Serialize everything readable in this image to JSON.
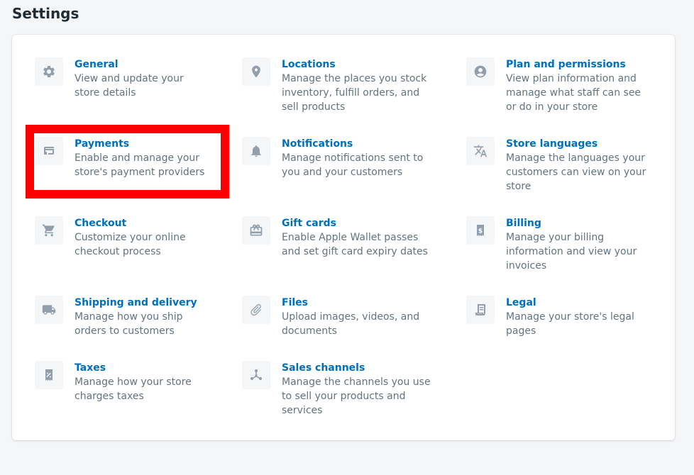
{
  "page_title": "Settings",
  "items": [
    {
      "title": "General",
      "desc_lines": [
        "View and update your",
        "store details"
      ],
      "icon": "gear-icon"
    },
    {
      "title": "Locations",
      "desc_lines": [
        "Manage the places you stock",
        "inventory, fulfill orders, and",
        "sell products"
      ],
      "icon": "location-pin-icon"
    },
    {
      "title": "Plan and permissions",
      "desc_lines": [
        "View plan information and",
        "manage what staff can see",
        "or do in your store"
      ],
      "icon": "user-circle-icon"
    },
    {
      "title": "Payments",
      "desc_lines": [
        "Enable and manage your",
        "store's payment providers"
      ],
      "icon": "credit-card-icon"
    },
    {
      "title": "Notifications",
      "desc_lines": [
        "Manage notifications sent to",
        "you and your customers"
      ],
      "icon": "bell-icon"
    },
    {
      "title": "Store languages",
      "desc_lines": [
        "Manage the languages your",
        "customers can view on your",
        "store"
      ],
      "icon": "translate-icon"
    },
    {
      "title": "Checkout",
      "desc_lines": [
        "Customize your online",
        "checkout process"
      ],
      "icon": "cart-icon"
    },
    {
      "title": "Gift cards",
      "desc_lines": [
        "Enable Apple Wallet passes",
        "and set gift card expiry dates"
      ],
      "icon": "gift-icon"
    },
    {
      "title": "Billing",
      "desc_lines": [
        "Manage your billing",
        "information and view your",
        "invoices"
      ],
      "icon": "billing-receipt-icon"
    },
    {
      "title": "Shipping and delivery",
      "desc_lines": [
        "Manage how you ship",
        "orders to customers"
      ],
      "icon": "truck-icon"
    },
    {
      "title": "Files",
      "desc_lines": [
        "Upload images, videos, and",
        "documents"
      ],
      "icon": "paperclip-icon"
    },
    {
      "title": "Legal",
      "desc_lines": [
        "Manage your store's legal",
        "pages"
      ],
      "icon": "legal-document-icon"
    },
    {
      "title": "Taxes",
      "desc_lines": [
        "Manage how your store",
        "charges taxes"
      ],
      "icon": "tax-receipt-icon"
    },
    {
      "title": "Sales channels",
      "desc_lines": [
        "Manage the channels you use",
        "to sell your products and",
        "services"
      ],
      "icon": "channels-icon"
    }
  ],
  "colors": {
    "link": "#006fbb",
    "description": "#637381",
    "icon": "#919eab",
    "highlight": "#ff0000"
  }
}
